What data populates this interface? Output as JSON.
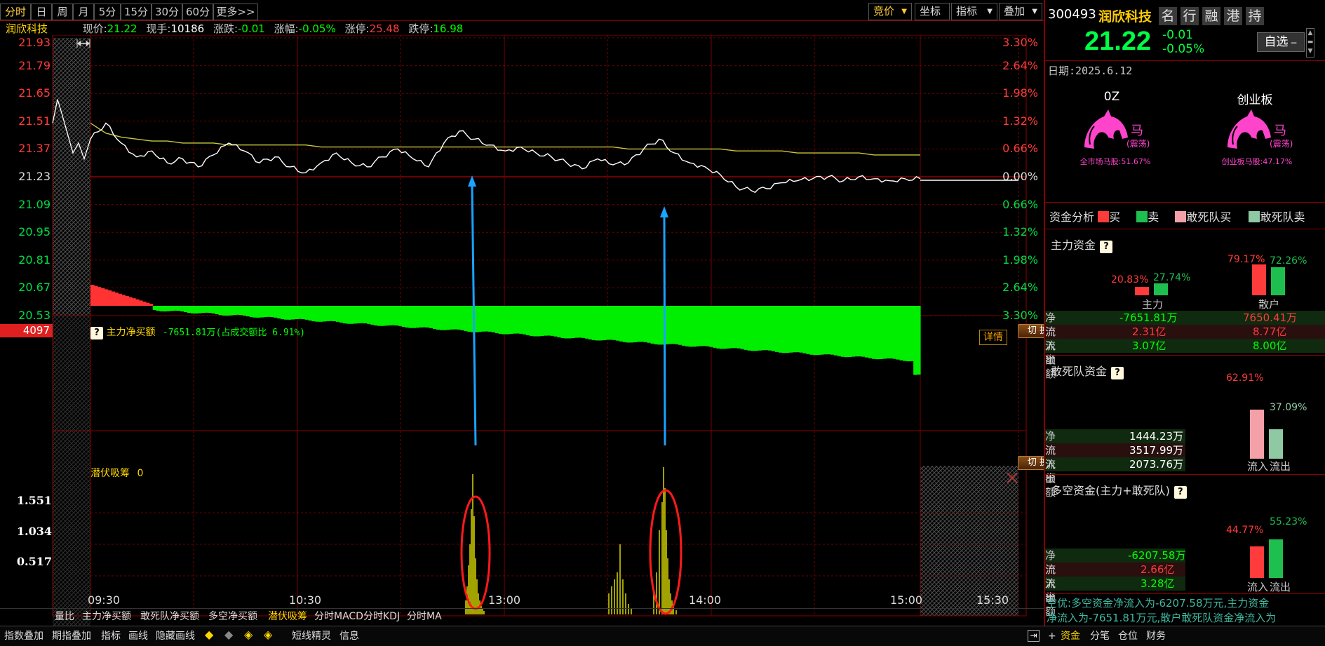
{
  "toolbar": {
    "tabs": [
      "分时",
      "日",
      "周",
      "月",
      "5分",
      "15分",
      "30分",
      "60分",
      "更多>>"
    ],
    "right": [
      "竞价",
      "坐标",
      "指标",
      "叠加"
    ]
  },
  "quote_line": {
    "name": "润欣科技",
    "price_label": "现价:",
    "price": "21.22",
    "hand_label": "现手:",
    "hand": "10186",
    "chg_label": "涨跌:",
    "chg": "-0.01",
    "pct_label": "涨幅:",
    "pct": "-0.05%",
    "up_label": "涨停:",
    "up_limit": "25.48",
    "down_label": "跌停:",
    "down_limit": "16.98"
  },
  "price_axis": {
    "left": [
      "21.93",
      "21.79",
      "21.65",
      "21.51",
      "21.37",
      "21.23",
      "21.09",
      "20.95",
      "20.81",
      "20.67",
      "20.53"
    ],
    "right": [
      "3.30%",
      "2.64%",
      "1.98%",
      "1.32%",
      "0.66%",
      "0.00%",
      "0.66%",
      "1.32%",
      "1.98%",
      "2.64%",
      "3.30%"
    ]
  },
  "time_axis": [
    "09:30",
    "10:30",
    "13:00",
    "14:00",
    "15:00",
    "15:30"
  ],
  "flow_panel": {
    "left_value": "4097",
    "q": "?",
    "title": "主力净买额",
    "summary": "-7651.81万(占成交额比 6.91%)",
    "detail_btn": "详情",
    "switch_btn": "切 换"
  },
  "absorb_panel": {
    "title": "潜伏吸筹",
    "value": "0",
    "switch_btn": "切 换",
    "axis": [
      "1.551",
      "1.034",
      "0.517"
    ]
  },
  "indicator_tabs": [
    "量比",
    "主力净买额",
    "敢死队净买额",
    "多空净买额",
    "潜伏吸筹",
    "分时MACD",
    "分时KDJ",
    "分时MA"
  ],
  "bottom_bar": {
    "items": [
      "指数叠加",
      "期指叠加",
      "指标",
      "画线",
      "隐藏画线"
    ],
    "items2": [
      "短线精灵",
      "信息"
    ],
    "right_tabs": [
      "+",
      "资金",
      "分笔",
      "仓位",
      "财务"
    ]
  },
  "stock": {
    "code": "300493",
    "name": "润欣科技",
    "buttons": [
      "名",
      "行",
      "融",
      "港",
      "持"
    ],
    "price": "21.22",
    "change": "-0.01",
    "change_pct": "-0.05%",
    "watch_btn": "自选"
  },
  "date": {
    "label": "日期:",
    "value": "2025.6.12"
  },
  "horses": [
    {
      "title": "0Z",
      "char": "马",
      "state": "(震荡)",
      "caption": "全市场马股:51.67%"
    },
    {
      "title": "创业板",
      "char": "马",
      "state": "(震荡)",
      "caption": "创业板马股:47.17%"
    }
  ],
  "legend": {
    "title": "资金分析",
    "items": [
      {
        "label": "买",
        "color": "#ff3b3b"
      },
      {
        "label": "卖",
        "color": "#1fbf4f"
      },
      {
        "label": "敢死队买",
        "color": "#f3a0a8"
      },
      {
        "label": "敢死队卖",
        "color": "#8fc9a3"
      }
    ]
  },
  "main_funds": {
    "title": "主力资金",
    "pcts": {
      "main_in": "20.83%",
      "main_out": "27.74%",
      "retail_in": "79.17%",
      "retail_out": "72.26%"
    },
    "bar_levels": {
      "main_in": 0.2083,
      "main_out": 0.2774,
      "retail_in": 0.7917,
      "retail_out": 0.7226
    },
    "cat_main": "主力",
    "cat_retail": "散户",
    "rows": [
      {
        "label": "净流入",
        "main": "-7651.81万",
        "retail": "7650.41万"
      },
      {
        "label": "流入额",
        "main": "2.31亿",
        "retail": "8.77亿"
      },
      {
        "label": "流出额",
        "main": "3.07亿",
        "retail": "8.00亿"
      }
    ]
  },
  "dare_funds": {
    "title": "敢死队资金",
    "pct_in": "62.91%",
    "pct_out": "37.09%",
    "bar_levels": {
      "in": 0.6291,
      "out": 0.3709
    },
    "rows": [
      {
        "label": "净流入",
        "value": "1444.23万"
      },
      {
        "label": "流入额",
        "value": "3517.99万"
      },
      {
        "label": "流出额",
        "value": "2073.76万"
      }
    ],
    "cat_in": "流入",
    "cat_out": "流出"
  },
  "long_short": {
    "title": "多空资金(主力+敢死队)",
    "pct_in": "44.77%",
    "pct_out": "55.23%",
    "bar_levels": {
      "in": 0.4477,
      "out": 0.5523
    },
    "rows": [
      {
        "label": "净流入",
        "value": "-6207.58万"
      },
      {
        "label": "流入额",
        "value": "2.66亿"
      },
      {
        "label": "流出额",
        "value": "3.28亿"
      }
    ],
    "cat_in": "流入",
    "cat_out": "流出"
  },
  "commentary": [
    "空优:多空资金净流入为-6207.58万元,主力资金",
    "净流入为-7651.81万元,散户敢死队资金净流入为"
  ],
  "chart_data": {
    "type": "line",
    "x_ticks": [
      "09:30",
      "10:30",
      "13:00",
      "14:00",
      "15:00",
      "15:30"
    ],
    "ylim": [
      20.53,
      21.93
    ],
    "price": [
      21.42,
      21.5,
      21.4,
      21.33,
      21.36,
      21.3,
      21.32,
      21.28,
      21.34,
      21.4,
      21.36,
      21.3,
      21.33,
      21.28,
      21.25,
      21.3,
      21.35,
      21.3,
      21.28,
      21.33,
      21.37,
      21.32,
      21.28,
      21.4,
      21.46,
      21.42,
      21.39,
      21.36,
      21.38,
      21.35,
      21.33,
      21.3,
      21.27,
      21.32,
      21.29,
      21.3,
      21.37,
      21.42,
      21.35,
      21.3,
      21.28,
      21.24,
      21.18,
      21.16,
      21.17,
      21.2,
      21.21,
      21.22,
      21.23,
      21.21,
      21.23,
      21.22,
      21.21,
      21.22,
      21.22
    ],
    "avg": [
      21.5,
      21.45,
      21.43,
      21.42,
      21.41,
      21.41,
      21.4,
      21.4,
      21.4,
      21.39,
      21.39,
      21.39,
      21.39,
      21.39,
      21.39,
      21.38,
      21.38,
      21.38,
      21.38,
      21.38,
      21.38,
      21.38,
      21.38,
      21.38,
      21.38,
      21.38,
      21.38,
      21.38,
      21.38,
      21.38,
      21.38,
      21.38,
      21.38,
      21.38,
      21.38,
      21.37,
      21.37,
      21.37,
      21.37,
      21.37,
      21.37,
      21.37,
      21.36,
      21.36,
      21.36,
      21.36,
      21.35,
      21.35,
      21.35,
      21.35,
      21.35,
      21.34,
      21.34,
      21.34,
      21.34
    ]
  }
}
